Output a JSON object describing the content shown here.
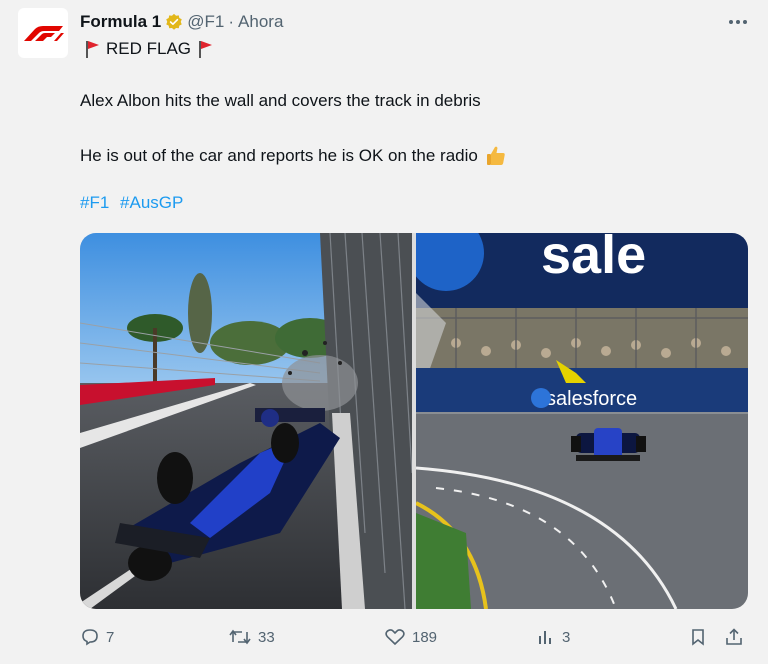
{
  "post": {
    "author": "Formula 1",
    "handle": "@F1",
    "separator": "·",
    "time": "Ahora",
    "title": "RED FLAG",
    "line1": "Alex Albon hits the wall and covers the track in debris",
    "line2": "He is out of the car and reports he is OK on the radio",
    "hashtags": [
      "#F1",
      "#AusGP"
    ],
    "emoji_icon": "thumbs-up-icon",
    "images": [
      {
        "name": "albon-crash-wall-photo"
      },
      {
        "name": "albon-car-on-track-photo",
        "banner_text": "sale",
        "ad_text": "salesforce"
      }
    ]
  },
  "actions": {
    "replies": "7",
    "reposts": "33",
    "likes": "189",
    "views": "3"
  },
  "colors": {
    "brand_red": "#e10600",
    "verified_gold": "#e2b719",
    "hashtag_blue": "#1d9bf0",
    "muted": "#536471",
    "background": "#f2f2f2"
  }
}
